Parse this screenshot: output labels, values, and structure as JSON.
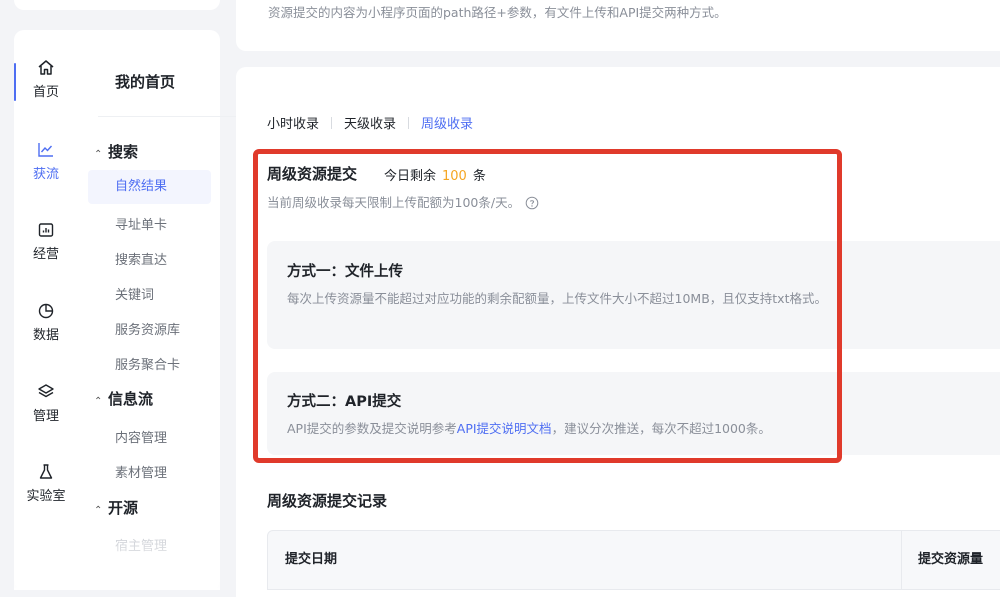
{
  "top": {
    "description": "资源提交的内容为小程序页面的path路径+参数，有文件上传和API提交两种方式。"
  },
  "rail": {
    "items": [
      {
        "label": "首页",
        "icon": "home-icon"
      },
      {
        "label": "获流",
        "icon": "trend-chart-icon"
      },
      {
        "label": "经营",
        "icon": "bar-chart-icon"
      },
      {
        "label": "数据",
        "icon": "pie-chart-icon"
      },
      {
        "label": "管理",
        "icon": "layers-icon"
      },
      {
        "label": "实验室",
        "icon": "flask-icon"
      }
    ]
  },
  "menu": {
    "home": "我的首页",
    "sections": [
      {
        "label": "搜索",
        "items": [
          "自然结果",
          "寻址单卡",
          "搜索直达",
          "关键词",
          "服务资源库",
          "服务聚合卡"
        ]
      },
      {
        "label": "信息流",
        "items": [
          "内容管理",
          "素材管理"
        ]
      },
      {
        "label": "开源",
        "items": [
          "宿主管理"
        ]
      }
    ],
    "active_item": "自然结果"
  },
  "tabs": [
    "小时收录",
    "天级收录",
    "周级收录"
  ],
  "selected_tab": "周级收录",
  "submit": {
    "title": "周级资源提交",
    "remain_prefix": "今日剩余",
    "remain_count": "100",
    "remain_suffix": "条",
    "limit_note": "当前周级收录每天限制上传配额为100条/天。"
  },
  "method1": {
    "title": "方式一：文件上传",
    "desc": "每次上传资源量不能超过对应功能的剩余配额量，上传文件大小不超过10MB，且仅支持txt格式。"
  },
  "method2": {
    "title": "方式二：API提交",
    "desc_before": "API提交的参数及提交说明参考",
    "doc_link": "API提交说明文档",
    "desc_after": "，建议分次推送，每次不超过1000条。"
  },
  "records": {
    "title": "周级资源提交记录",
    "columns": [
      "提交日期",
      "提交资源量"
    ]
  },
  "colors": {
    "accent": "#4e6ef2",
    "count_highlight": "#f5a623",
    "annotation_box": "#e03a2b"
  }
}
